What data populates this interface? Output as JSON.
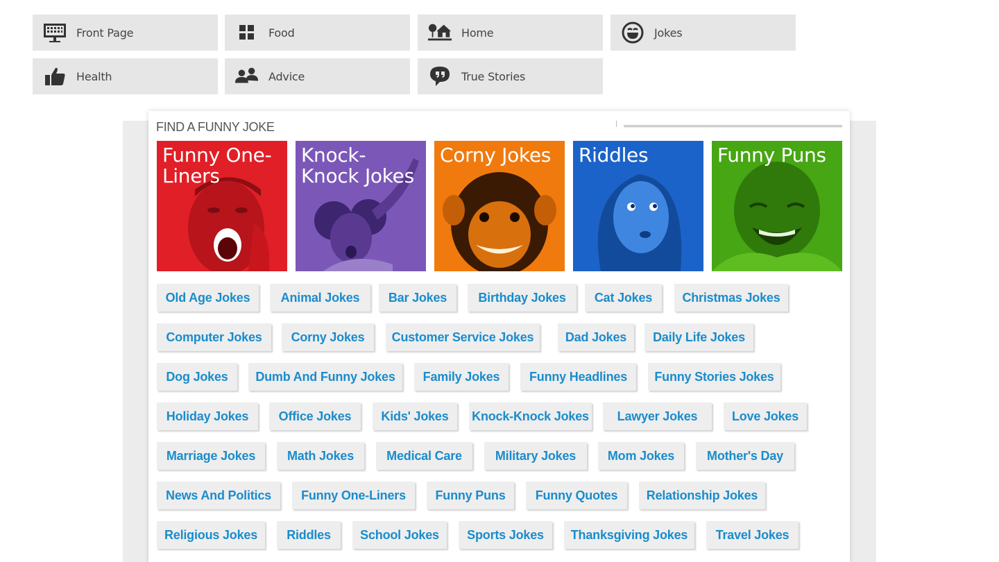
{
  "nav": {
    "items": [
      {
        "label": "Front Page",
        "icon": "monitor-icon"
      },
      {
        "label": "Food",
        "icon": "grid-icon"
      },
      {
        "label": "Home",
        "icon": "house-tree-icon"
      },
      {
        "label": "Jokes",
        "icon": "smiley-icon"
      },
      {
        "label": "Health",
        "icon": "thumbs-up-icon"
      },
      {
        "label": "Advice",
        "icon": "people-icon"
      },
      {
        "label": "True Stories",
        "icon": "speech-bubble-icon"
      }
    ]
  },
  "section": {
    "title": "FIND A FUNNY JOKE",
    "categories": [
      {
        "label": "Funny One-Liners",
        "color": "#e01f27"
      },
      {
        "label": "Knock-Knock Jokes",
        "color": "#7b58b8"
      },
      {
        "label": "Corny Jokes",
        "color": "#f07a0d"
      },
      {
        "label": "Riddles",
        "color": "#1b63c9"
      },
      {
        "label": "Funny Puns",
        "color": "#46a613"
      }
    ],
    "tags": [
      [
        "Old Age Jokes",
        "Animal Jokes",
        "Bar Jokes",
        "Birthday Jokes",
        "Cat Jokes",
        "Christmas Jokes"
      ],
      [
        "Computer Jokes",
        "Corny Jokes",
        "Customer Service Jokes",
        "Dad Jokes",
        "Daily Life Jokes"
      ],
      [
        "Dog Jokes",
        "Dumb And Funny Jokes",
        "Family Jokes",
        "Funny Headlines",
        "Funny Stories Jokes"
      ],
      [
        "Holiday Jokes",
        "Office Jokes",
        "Kids' Jokes",
        "Knock-Knock Jokes",
        "Lawyer Jokes",
        "Love Jokes"
      ],
      [
        "Marriage Jokes",
        "Math Jokes",
        "Medical Care",
        "Military Jokes",
        "Mom Jokes",
        "Mother's Day"
      ],
      [
        "News And Politics",
        "Funny One-Liners",
        "Funny Puns",
        "Funny Quotes",
        "Relationship Jokes"
      ],
      [
        "Religious Jokes",
        "Riddles",
        "School Jokes",
        "Sports Jokes",
        "Thanksgiving Jokes",
        "Travel Jokes"
      ]
    ]
  },
  "colors": {
    "tag_text": "#1a8ccc",
    "tag_bg": "#eeeeee",
    "nav_bg": "#e6e6e6"
  }
}
